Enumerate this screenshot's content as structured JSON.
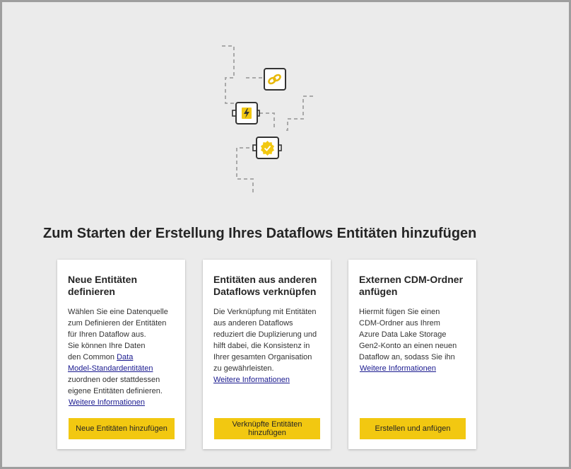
{
  "colors": {
    "accent": "#f2c811",
    "background": "#ebebeb",
    "card": "#ffffff",
    "link": "#1a1a8f",
    "text": "#252525"
  },
  "illustration": {
    "icons": [
      "link-icon",
      "lightning-icon",
      "certified-badge-icon"
    ]
  },
  "headline": "Zum Starten der Erstellung Ihres Dataflows Entitäten hinzufügen",
  "cards": [
    {
      "title": "Neue Entitäten definieren",
      "body_lines": [
        "Wählen Sie eine Datenquelle",
        "zum Definieren der Entitäten",
        "für Ihren Dataflow aus.",
        "Sie können Ihre Daten"
      ],
      "body_pre_link": "den Common ",
      "body_link_part1": "Data",
      "body_link_part2": "Model-Standardentitäten",
      "body_after_lines": [
        "zuordnen oder stattdessen",
        "eigene Entitäten definieren."
      ],
      "more_link": "Weitere Informationen",
      "button": "Neue Entitäten hinzufügen"
    },
    {
      "title": "Entitäten aus anderen Dataflows verknüpfen",
      "body_lines": [
        "Die Verknüpfung mit Entitäten",
        "aus anderen Dataflows",
        "reduziert die Duplizierung und",
        "hilft dabei, die Konsistenz in",
        "Ihrer gesamten Organisation",
        "zu gewährleisten."
      ],
      "more_link": "Weitere Informationen",
      "button": "Verknüpfte Entitäten hinzufügen"
    },
    {
      "title": "Externen CDM-Ordner anfügen",
      "body_lines": [
        "Hiermit fügen Sie einen",
        "CDM-Ordner aus Ihrem",
        "Azure Data Lake Storage",
        "Gen2-Konto an einen neuen",
        "Dataflow an, sodass Sie ihn"
      ],
      "more_link": "Weitere Informationen",
      "button": "Erstellen und anfügen"
    }
  ]
}
